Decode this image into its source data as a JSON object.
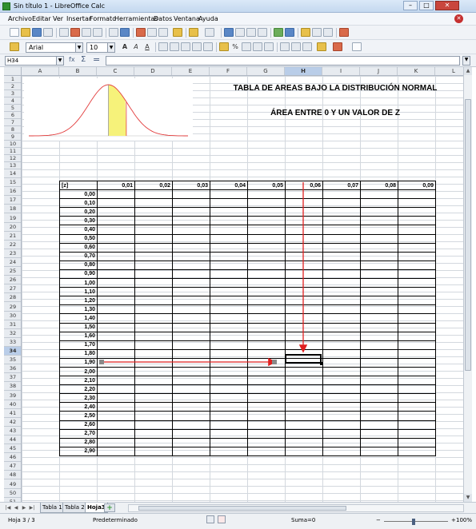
{
  "window": {
    "title": "Sin título 1 - LibreOffice Calc",
    "controls": [
      "–",
      "□",
      "✕"
    ]
  },
  "menu": {
    "items": [
      "Archivo",
      "Editar",
      "Ver",
      "Insertar",
      "Formato",
      "Herramientas",
      "Datos",
      "Ventana",
      "Ayuda"
    ]
  },
  "format_toolbar": {
    "font_name": "Arial",
    "font_size": "10"
  },
  "formula_bar": {
    "cell_ref": "H34",
    "fx": "fx",
    "sum": "Σ",
    "equals": "="
  },
  "columns": [
    "A",
    "B",
    "C",
    "D",
    "E",
    "F",
    "G",
    "H",
    "I",
    "J",
    "K",
    "L"
  ],
  "selected_column": "H",
  "rows_start": 1,
  "rows_end": 51,
  "selected_row": 34,
  "sheet": {
    "title": "TABLA DE AREAS BAJO LA DISTRIBUCIÓN NORMAL",
    "subtitle": "ÁREA ENTRE 0 Y UN VALOR DE Z",
    "z_header": "[z]",
    "col_headers": [
      "0,01",
      "0,02",
      "0,03",
      "0,04",
      "0,05",
      "0,06",
      "0,07",
      "0,08",
      "0,09"
    ],
    "z_values": [
      "0,00",
      "0,10",
      "0,20",
      "0,30",
      "0,40",
      "0,50",
      "0,60",
      "0,70",
      "0,80",
      "0,90",
      "1,00",
      "1,10",
      "1,20",
      "1,30",
      "1,40",
      "1,50",
      "1,60",
      "1,70",
      "1,80",
      "1,90",
      "2,00",
      "2,10",
      "2,20",
      "2,30",
      "2,40",
      "2,50",
      "2,60",
      "2,70",
      "2,80",
      "2,90"
    ],
    "highlight_row_z": "1,90",
    "highlight_col": "0,06",
    "arrow_color": "#e02020"
  },
  "sheet_tabs": [
    "Tabla 1",
    "Tabla 2",
    "Hoja3"
  ],
  "active_tab": "Hoja3",
  "status": {
    "sheet": "Hoja 3 / 3",
    "style": "Predeterminado",
    "sum": "Suma=0",
    "zoom": "100%"
  }
}
